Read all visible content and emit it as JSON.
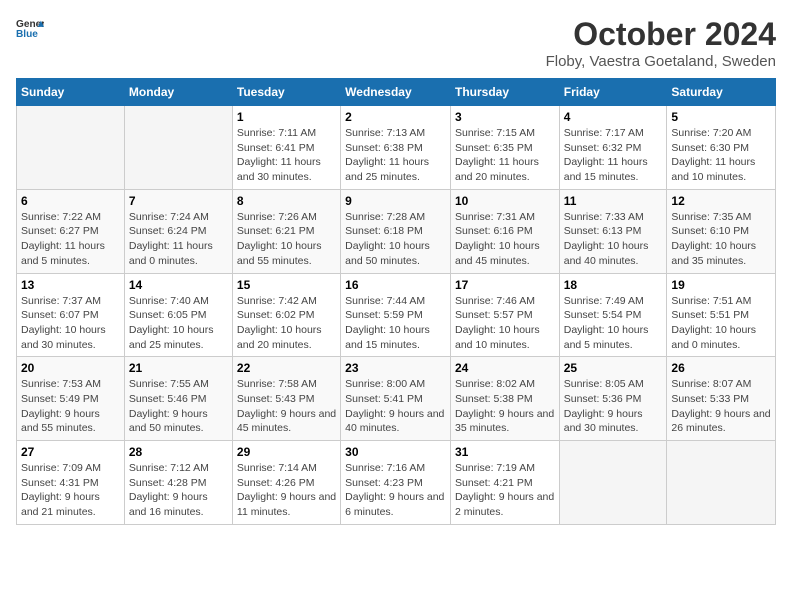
{
  "header": {
    "logo": {
      "text_general": "General",
      "text_blue": "Blue"
    },
    "title": "October 2024",
    "subtitle": "Floby, Vaestra Goetaland, Sweden"
  },
  "weekdays": [
    "Sunday",
    "Monday",
    "Tuesday",
    "Wednesday",
    "Thursday",
    "Friday",
    "Saturday"
  ],
  "weeks": [
    [
      {
        "empty": true
      },
      {
        "empty": true
      },
      {
        "day": 1,
        "sunrise": "Sunrise: 7:11 AM",
        "sunset": "Sunset: 6:41 PM",
        "daylight": "Daylight: 11 hours and 30 minutes."
      },
      {
        "day": 2,
        "sunrise": "Sunrise: 7:13 AM",
        "sunset": "Sunset: 6:38 PM",
        "daylight": "Daylight: 11 hours and 25 minutes."
      },
      {
        "day": 3,
        "sunrise": "Sunrise: 7:15 AM",
        "sunset": "Sunset: 6:35 PM",
        "daylight": "Daylight: 11 hours and 20 minutes."
      },
      {
        "day": 4,
        "sunrise": "Sunrise: 7:17 AM",
        "sunset": "Sunset: 6:32 PM",
        "daylight": "Daylight: 11 hours and 15 minutes."
      },
      {
        "day": 5,
        "sunrise": "Sunrise: 7:20 AM",
        "sunset": "Sunset: 6:30 PM",
        "daylight": "Daylight: 11 hours and 10 minutes."
      }
    ],
    [
      {
        "day": 6,
        "sunrise": "Sunrise: 7:22 AM",
        "sunset": "Sunset: 6:27 PM",
        "daylight": "Daylight: 11 hours and 5 minutes."
      },
      {
        "day": 7,
        "sunrise": "Sunrise: 7:24 AM",
        "sunset": "Sunset: 6:24 PM",
        "daylight": "Daylight: 11 hours and 0 minutes."
      },
      {
        "day": 8,
        "sunrise": "Sunrise: 7:26 AM",
        "sunset": "Sunset: 6:21 PM",
        "daylight": "Daylight: 10 hours and 55 minutes."
      },
      {
        "day": 9,
        "sunrise": "Sunrise: 7:28 AM",
        "sunset": "Sunset: 6:18 PM",
        "daylight": "Daylight: 10 hours and 50 minutes."
      },
      {
        "day": 10,
        "sunrise": "Sunrise: 7:31 AM",
        "sunset": "Sunset: 6:16 PM",
        "daylight": "Daylight: 10 hours and 45 minutes."
      },
      {
        "day": 11,
        "sunrise": "Sunrise: 7:33 AM",
        "sunset": "Sunset: 6:13 PM",
        "daylight": "Daylight: 10 hours and 40 minutes."
      },
      {
        "day": 12,
        "sunrise": "Sunrise: 7:35 AM",
        "sunset": "Sunset: 6:10 PM",
        "daylight": "Daylight: 10 hours and 35 minutes."
      }
    ],
    [
      {
        "day": 13,
        "sunrise": "Sunrise: 7:37 AM",
        "sunset": "Sunset: 6:07 PM",
        "daylight": "Daylight: 10 hours and 30 minutes."
      },
      {
        "day": 14,
        "sunrise": "Sunrise: 7:40 AM",
        "sunset": "Sunset: 6:05 PM",
        "daylight": "Daylight: 10 hours and 25 minutes."
      },
      {
        "day": 15,
        "sunrise": "Sunrise: 7:42 AM",
        "sunset": "Sunset: 6:02 PM",
        "daylight": "Daylight: 10 hours and 20 minutes."
      },
      {
        "day": 16,
        "sunrise": "Sunrise: 7:44 AM",
        "sunset": "Sunset: 5:59 PM",
        "daylight": "Daylight: 10 hours and 15 minutes."
      },
      {
        "day": 17,
        "sunrise": "Sunrise: 7:46 AM",
        "sunset": "Sunset: 5:57 PM",
        "daylight": "Daylight: 10 hours and 10 minutes."
      },
      {
        "day": 18,
        "sunrise": "Sunrise: 7:49 AM",
        "sunset": "Sunset: 5:54 PM",
        "daylight": "Daylight: 10 hours and 5 minutes."
      },
      {
        "day": 19,
        "sunrise": "Sunrise: 7:51 AM",
        "sunset": "Sunset: 5:51 PM",
        "daylight": "Daylight: 10 hours and 0 minutes."
      }
    ],
    [
      {
        "day": 20,
        "sunrise": "Sunrise: 7:53 AM",
        "sunset": "Sunset: 5:49 PM",
        "daylight": "Daylight: 9 hours and 55 minutes."
      },
      {
        "day": 21,
        "sunrise": "Sunrise: 7:55 AM",
        "sunset": "Sunset: 5:46 PM",
        "daylight": "Daylight: 9 hours and 50 minutes."
      },
      {
        "day": 22,
        "sunrise": "Sunrise: 7:58 AM",
        "sunset": "Sunset: 5:43 PM",
        "daylight": "Daylight: 9 hours and 45 minutes."
      },
      {
        "day": 23,
        "sunrise": "Sunrise: 8:00 AM",
        "sunset": "Sunset: 5:41 PM",
        "daylight": "Daylight: 9 hours and 40 minutes."
      },
      {
        "day": 24,
        "sunrise": "Sunrise: 8:02 AM",
        "sunset": "Sunset: 5:38 PM",
        "daylight": "Daylight: 9 hours and 35 minutes."
      },
      {
        "day": 25,
        "sunrise": "Sunrise: 8:05 AM",
        "sunset": "Sunset: 5:36 PM",
        "daylight": "Daylight: 9 hours and 30 minutes."
      },
      {
        "day": 26,
        "sunrise": "Sunrise: 8:07 AM",
        "sunset": "Sunset: 5:33 PM",
        "daylight": "Daylight: 9 hours and 26 minutes."
      }
    ],
    [
      {
        "day": 27,
        "sunrise": "Sunrise: 7:09 AM",
        "sunset": "Sunset: 4:31 PM",
        "daylight": "Daylight: 9 hours and 21 minutes."
      },
      {
        "day": 28,
        "sunrise": "Sunrise: 7:12 AM",
        "sunset": "Sunset: 4:28 PM",
        "daylight": "Daylight: 9 hours and 16 minutes."
      },
      {
        "day": 29,
        "sunrise": "Sunrise: 7:14 AM",
        "sunset": "Sunset: 4:26 PM",
        "daylight": "Daylight: 9 hours and 11 minutes."
      },
      {
        "day": 30,
        "sunrise": "Sunrise: 7:16 AM",
        "sunset": "Sunset: 4:23 PM",
        "daylight": "Daylight: 9 hours and 6 minutes."
      },
      {
        "day": 31,
        "sunrise": "Sunrise: 7:19 AM",
        "sunset": "Sunset: 4:21 PM",
        "daylight": "Daylight: 9 hours and 2 minutes."
      },
      {
        "empty": true
      },
      {
        "empty": true
      }
    ]
  ]
}
